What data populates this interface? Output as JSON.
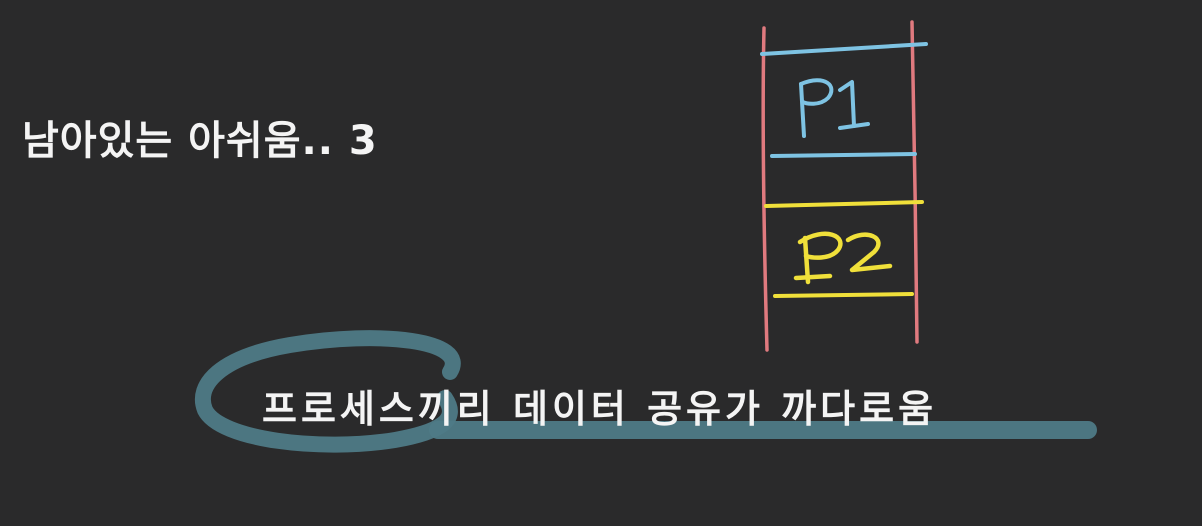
{
  "slide": {
    "title": "남아있는 아쉬움.. 3",
    "caption": "프로세스끼리 데이터 공유가 까다로움"
  },
  "memory_diagram": {
    "blocks": [
      {
        "label": "P1",
        "color": "#7ec3e3"
      },
      {
        "label": "P2",
        "color": "#f0e03a"
      }
    ],
    "wall_color": "#e07a7f"
  },
  "annotation": {
    "highlight_color": "#4e7a86"
  },
  "colors": {
    "background": "#2a2a2b",
    "text": "#f4f4f4"
  }
}
